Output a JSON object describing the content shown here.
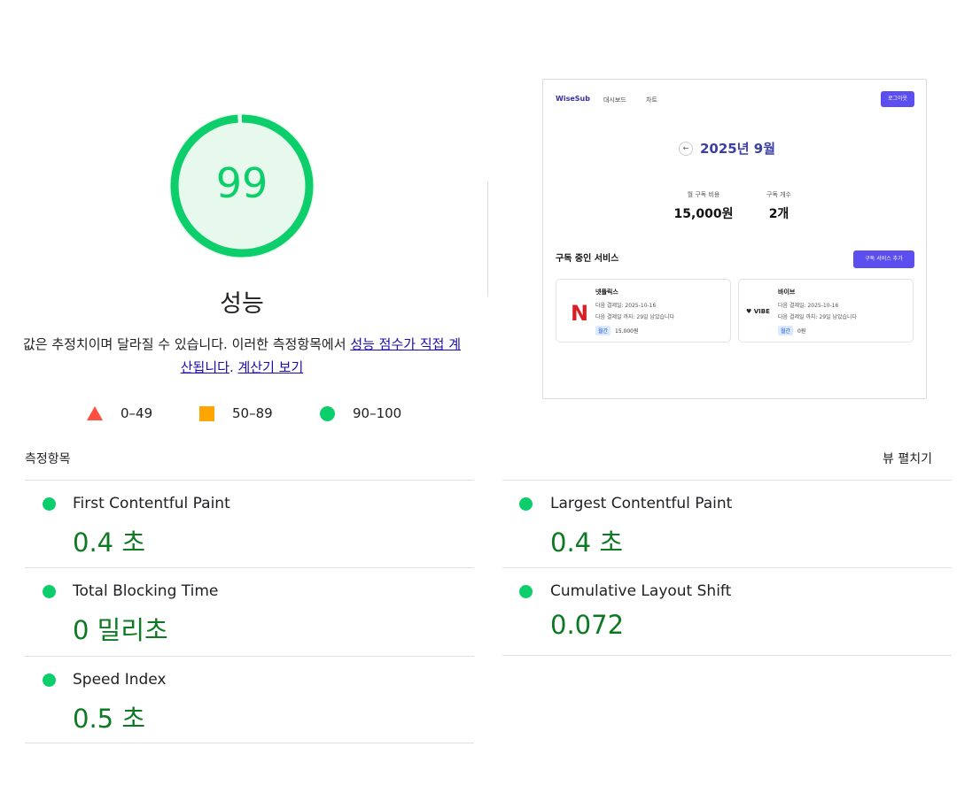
{
  "score": {
    "value": "99",
    "fraction": 0.99,
    "title": "성능",
    "color": "#0cce6b",
    "background": "#e7f8ed"
  },
  "description": {
    "text_before": "값은 추정치이며 달라질 수 있습니다. 이러한 측정항목에서 ",
    "link1": "성능 점수가 직접 계산됩니다",
    "separator": ". ",
    "link2": "계산기 보기"
  },
  "legend": {
    "fail": {
      "range": "0–49",
      "color": "#ff4e42",
      "icon": "triangle-icon"
    },
    "average": {
      "range": "50–89",
      "color": "#ffa400",
      "icon": "square-icon"
    },
    "pass": {
      "range": "90–100",
      "color": "#0cce6b",
      "icon": "circle-icon"
    }
  },
  "screenshot": {
    "logo": "WiseSub",
    "nav": [
      "대시보드",
      "차트"
    ],
    "logout": "로그아웃",
    "back_icon": "←",
    "month": "2025년 9월",
    "stats": [
      {
        "label": "월 구독 비용",
        "value": "15,000원"
      },
      {
        "label": "구독 개수",
        "value": "2개"
      }
    ],
    "section_title": "구독 중인 서비스",
    "add_button": "구독 서비스 추가",
    "cards": [
      {
        "logo": "N",
        "name": "넷플릭스",
        "next_payment": "다음 결제일: 2025-10-16",
        "remaining": "다음 결제일 까지: 29일 남았습니다",
        "cycle": "월간",
        "price": "15,000원"
      },
      {
        "logo": "♥ VIBE",
        "name": "바이브",
        "next_payment": "다음 결제일: 2025-10-16",
        "remaining": "다음 결제일 까지: 29일 남았습니다",
        "cycle": "월간",
        "price": "0원"
      }
    ]
  },
  "metrics": {
    "header": "측정항목",
    "expand": "뷰 펼치기",
    "items": [
      {
        "title": "First Contentful Paint",
        "value": "0.4 초"
      },
      {
        "title": "Largest Contentful Paint",
        "value": "0.4 초"
      },
      {
        "title": "Total Blocking Time",
        "value": "0 밀리초"
      },
      {
        "title": "Cumulative Layout Shift",
        "value": "0.072"
      },
      {
        "title": "Speed Index",
        "value": "0.5 초"
      }
    ]
  }
}
